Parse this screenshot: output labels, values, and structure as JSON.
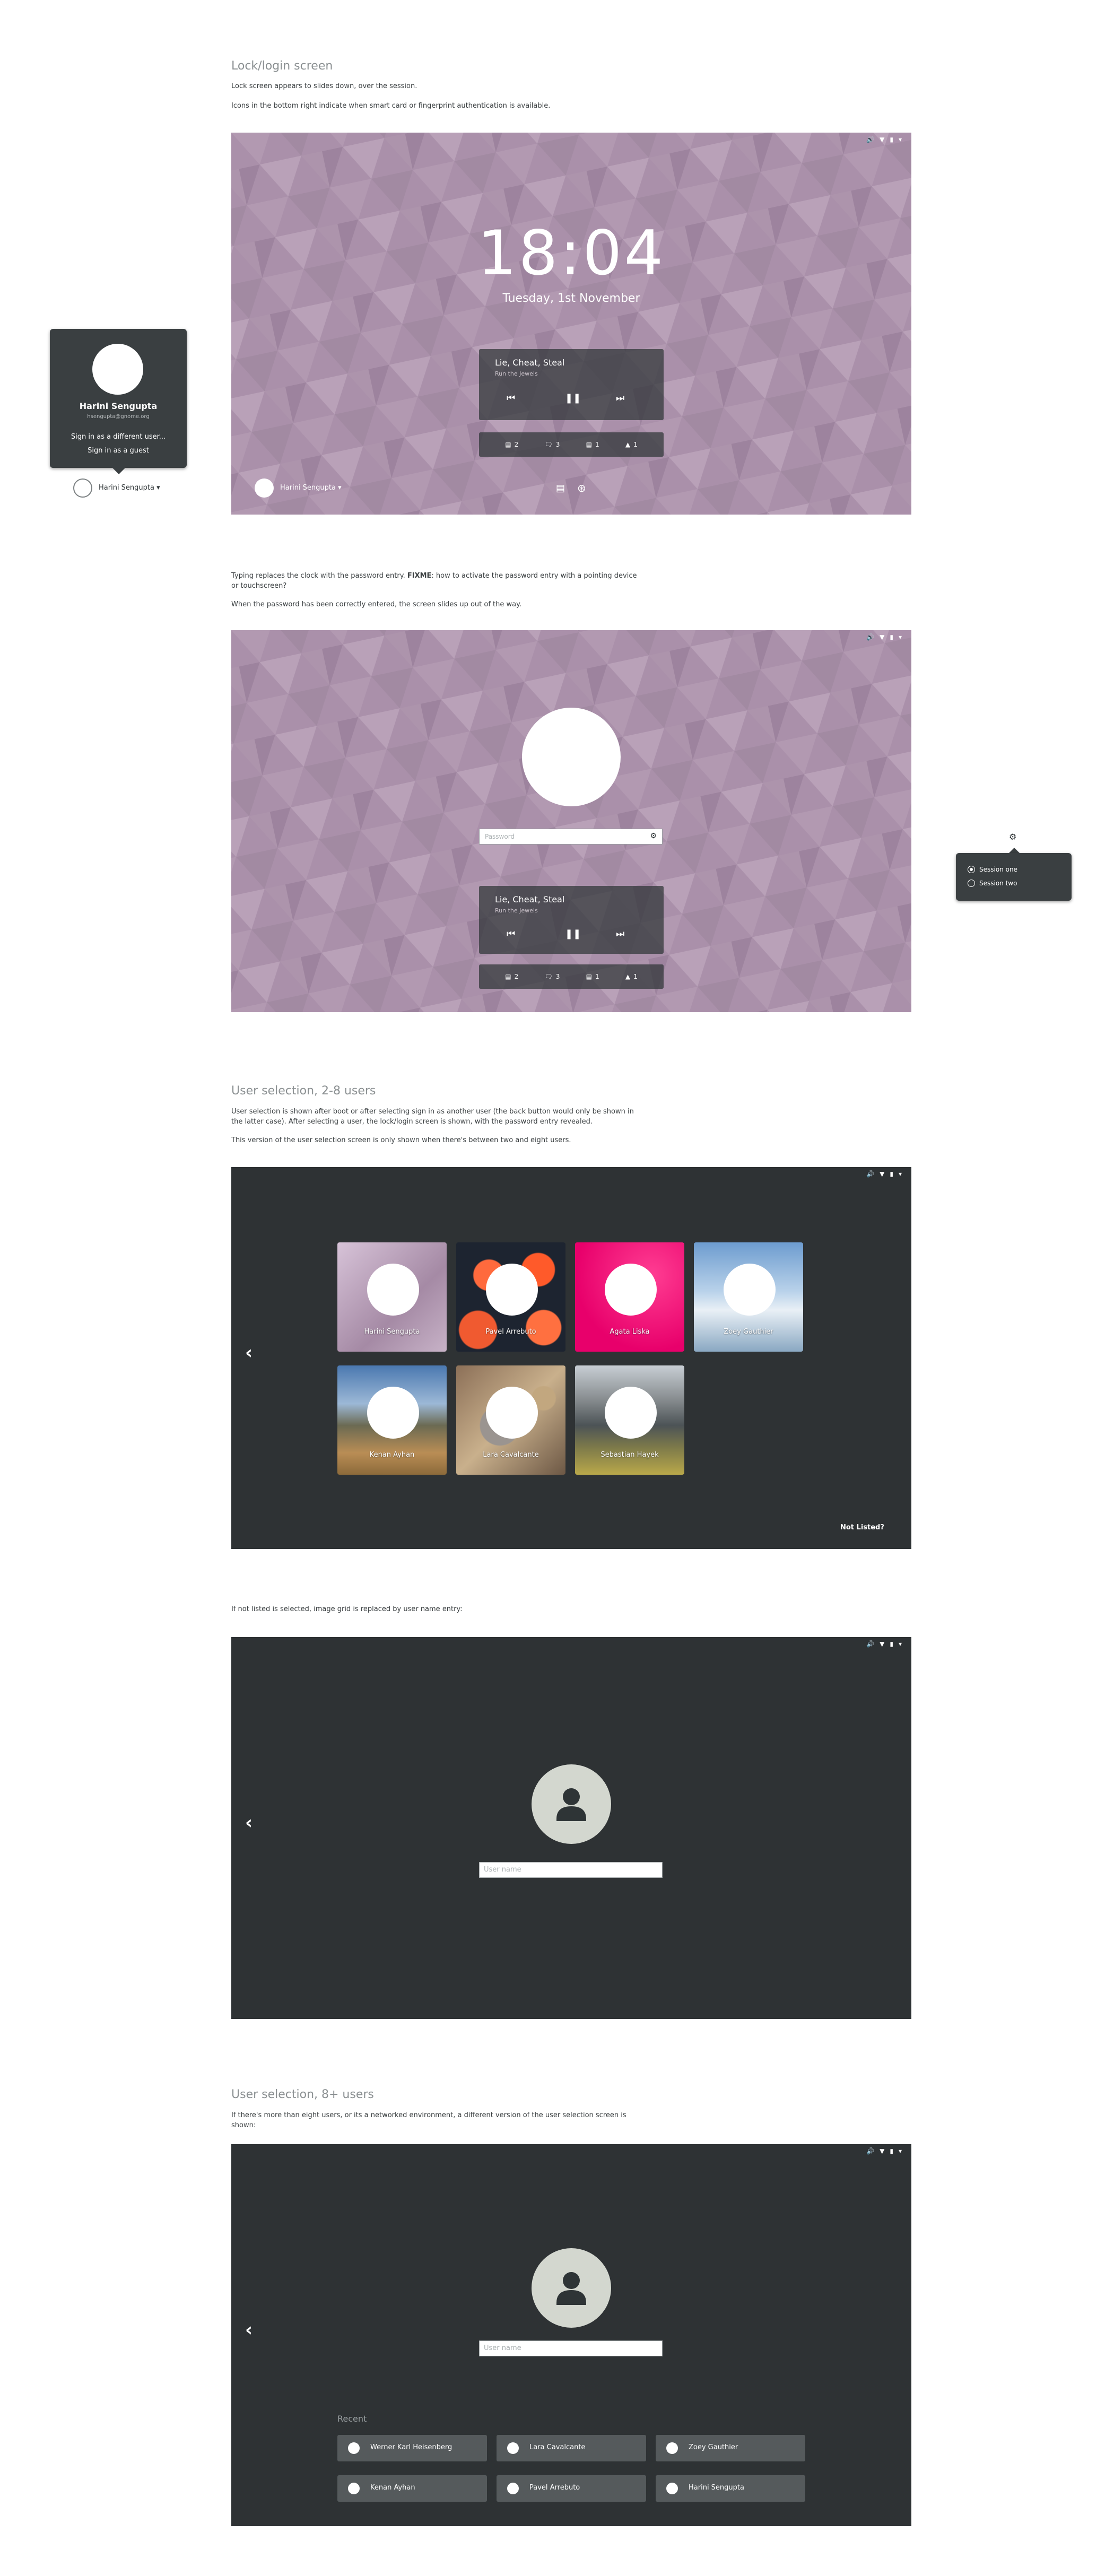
{
  "section1": {
    "title": "Lock/login screen",
    "p1": "Lock screen appears to slides down, over the session.",
    "p2": "Icons in the bottom right indicate when smart card or fingerprint authentication is available.",
    "clock": "18:04",
    "date": "Tuesday, 1st November",
    "media": {
      "song": "Lie, Cheat, Steal",
      "artist": "Run the Jewels"
    },
    "notifications": [
      "2",
      "3",
      "1",
      "1"
    ],
    "user_name": "Harini Sengupta",
    "popover": {
      "name": "Harini Sengupta",
      "email": "hsengupta@gnome.org",
      "item1": "Sign in as a different user...",
      "item2": "Sign in as a guest",
      "user_label": "Harini Sengupta"
    }
  },
  "section2": {
    "p1_a": "Typing replaces the clock with the password entry. ",
    "p1_b": "FIXME",
    "p1_c": ": how to activate the password entry with a pointing device or touchscreen?",
    "p2": "When the password has been correctly entered, the screen slides up out of the way.",
    "password_placeholder": "Password",
    "media": {
      "song": "Lie, Cheat, Steal",
      "artist": "Run the Jewels"
    },
    "notifications": [
      "2",
      "3",
      "1",
      "1"
    ],
    "session_menu": {
      "option1": "Session one",
      "option2": "Session two"
    }
  },
  "section3": {
    "title": "User selection, 2-8 users",
    "p1": "User selection is shown after boot or after selecting sign in as another user (the back button would only be shown in the latter case). After selecting a user, the lock/login screen is shown, with the password entry revealed.",
    "p2": "This version of the user selection screen is only shown when there's between two and eight users.",
    "users": [
      "Harini Sengupta",
      "Pavel Arrebuto",
      "Agata Liska",
      "Zoey Gauthier",
      "Kenan Ayhan",
      "Lara Cavalcante",
      "Sebastian Hayek"
    ],
    "not_listed": "Not Listed?"
  },
  "section4": {
    "p1": "If not listed is selected, image grid is replaced by user name entry:",
    "username_placeholder": "User name"
  },
  "section5": {
    "title": "User selection, 8+ users",
    "p1": "If there's more than eight users, or its a networked environment, a different version of the user selection screen is shown:",
    "username_placeholder": "User name",
    "recent_label": "Recent",
    "recent": [
      "Werner Karl Heisenberg",
      "Lara Cavalcante",
      "Zoey Gauthier",
      "Kenan Ayhan",
      "Pavel Arrebuto",
      "Harini Sengupta"
    ]
  },
  "colors": {
    "wallpaper": "#a58aa5",
    "dark_bg": "#2e3234",
    "panel": "#3a3f41"
  }
}
